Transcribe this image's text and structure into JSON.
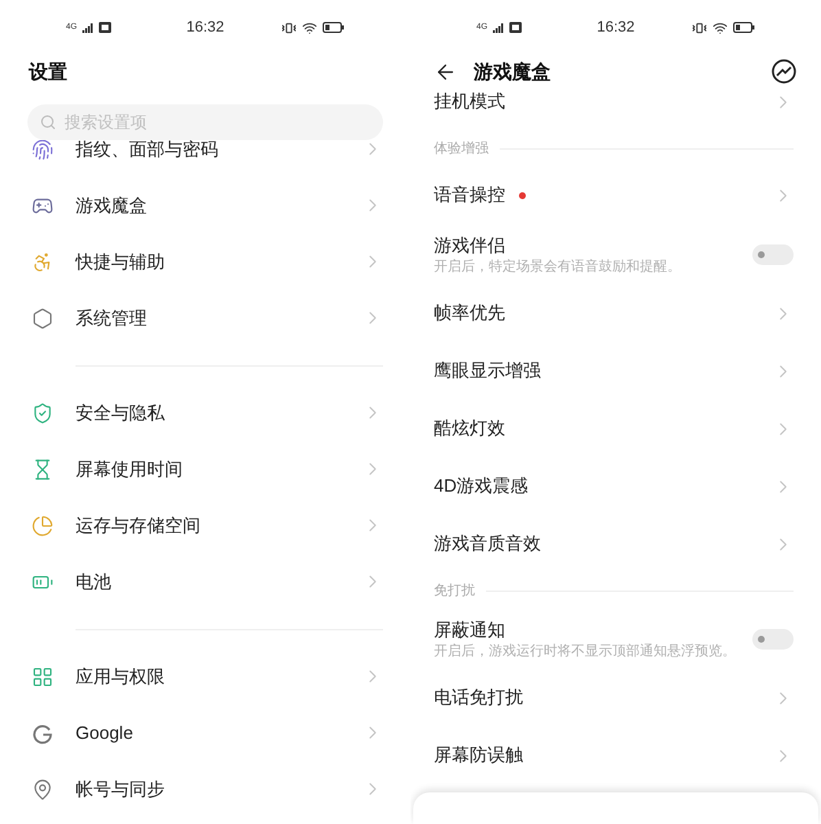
{
  "left_screen": {
    "status_bar": {
      "network": "4G",
      "time": "16:32"
    },
    "title": "设置",
    "search": {
      "placeholder": "搜索设置项"
    },
    "groups": [
      [
        {
          "label": "指纹、面部与密码"
        },
        {
          "label": "游戏魔盒"
        },
        {
          "label": "快捷与辅助"
        },
        {
          "label": "系统管理"
        }
      ],
      [
        {
          "label": "安全与隐私"
        },
        {
          "label": "屏幕使用时间"
        },
        {
          "label": "运存与存储空间"
        },
        {
          "label": "电池"
        }
      ],
      [
        {
          "label": "应用与权限"
        },
        {
          "label": "Google"
        },
        {
          "label": "帐号与同步"
        }
      ]
    ]
  },
  "right_screen": {
    "status_bar": {
      "network": "4G",
      "time": "16:32"
    },
    "title": "游戏魔盒",
    "items": [
      {
        "kind": "link",
        "label": "挂机模式"
      },
      {
        "kind": "section",
        "label": "体验增强"
      },
      {
        "kind": "link",
        "label": "语音操控",
        "badge": true
      },
      {
        "kind": "toggle",
        "label": "游戏伴侣",
        "description": "开启后，特定场景会有语音鼓励和提醒。",
        "on": false
      },
      {
        "kind": "link",
        "label": "帧率优先"
      },
      {
        "kind": "link",
        "label": "鹰眼显示增强"
      },
      {
        "kind": "link",
        "label": "酷炫灯效"
      },
      {
        "kind": "link",
        "label": "4D游戏震感"
      },
      {
        "kind": "link",
        "label": "游戏音质音效"
      },
      {
        "kind": "section",
        "label": "免打扰"
      },
      {
        "kind": "toggle",
        "label": "屏蔽通知",
        "description": "开启后，游戏运行时将不显示顶部通知悬浮预览。",
        "on": false
      },
      {
        "kind": "link",
        "label": "电话免打扰"
      },
      {
        "kind": "link",
        "label": "屏幕防误触"
      }
    ]
  }
}
